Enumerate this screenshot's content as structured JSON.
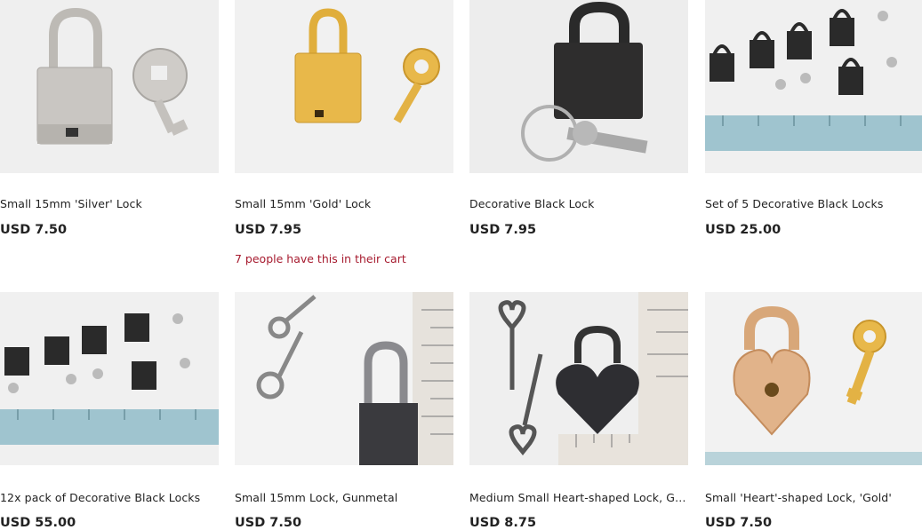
{
  "products": [
    {
      "title": "Small 15mm 'Silver' Lock",
      "price": "USD 7.50",
      "note": ""
    },
    {
      "title": "Small 15mm 'Gold' Lock",
      "price": "USD 7.95",
      "note": "7 people have this in their cart"
    },
    {
      "title": "Decorative Black Lock",
      "price": "USD 7.95",
      "note": ""
    },
    {
      "title": "Set of 5 Decorative Black Locks",
      "price": "USD 25.00",
      "note": ""
    },
    {
      "title": "12x pack of Decorative Black Locks",
      "price": "USD 55.00",
      "note": ""
    },
    {
      "title": "Small 15mm Lock, Gunmetal",
      "price": "USD 7.50",
      "note": ""
    },
    {
      "title": "Medium Small Heart-shaped Lock, Gu...",
      "price": "USD 8.75",
      "note": ""
    },
    {
      "title": "Small 'Heart'-shaped Lock, 'Gold'",
      "price": "USD 7.50",
      "note": ""
    }
  ],
  "colors": {
    "note": "#a61a2e",
    "text": "#222222",
    "silver": "#c9c6c2",
    "gold": "#e8b84a",
    "black": "#2a2a2a",
    "gunmetal": "#4a4a4e",
    "ruler": "#9fc4cf"
  }
}
